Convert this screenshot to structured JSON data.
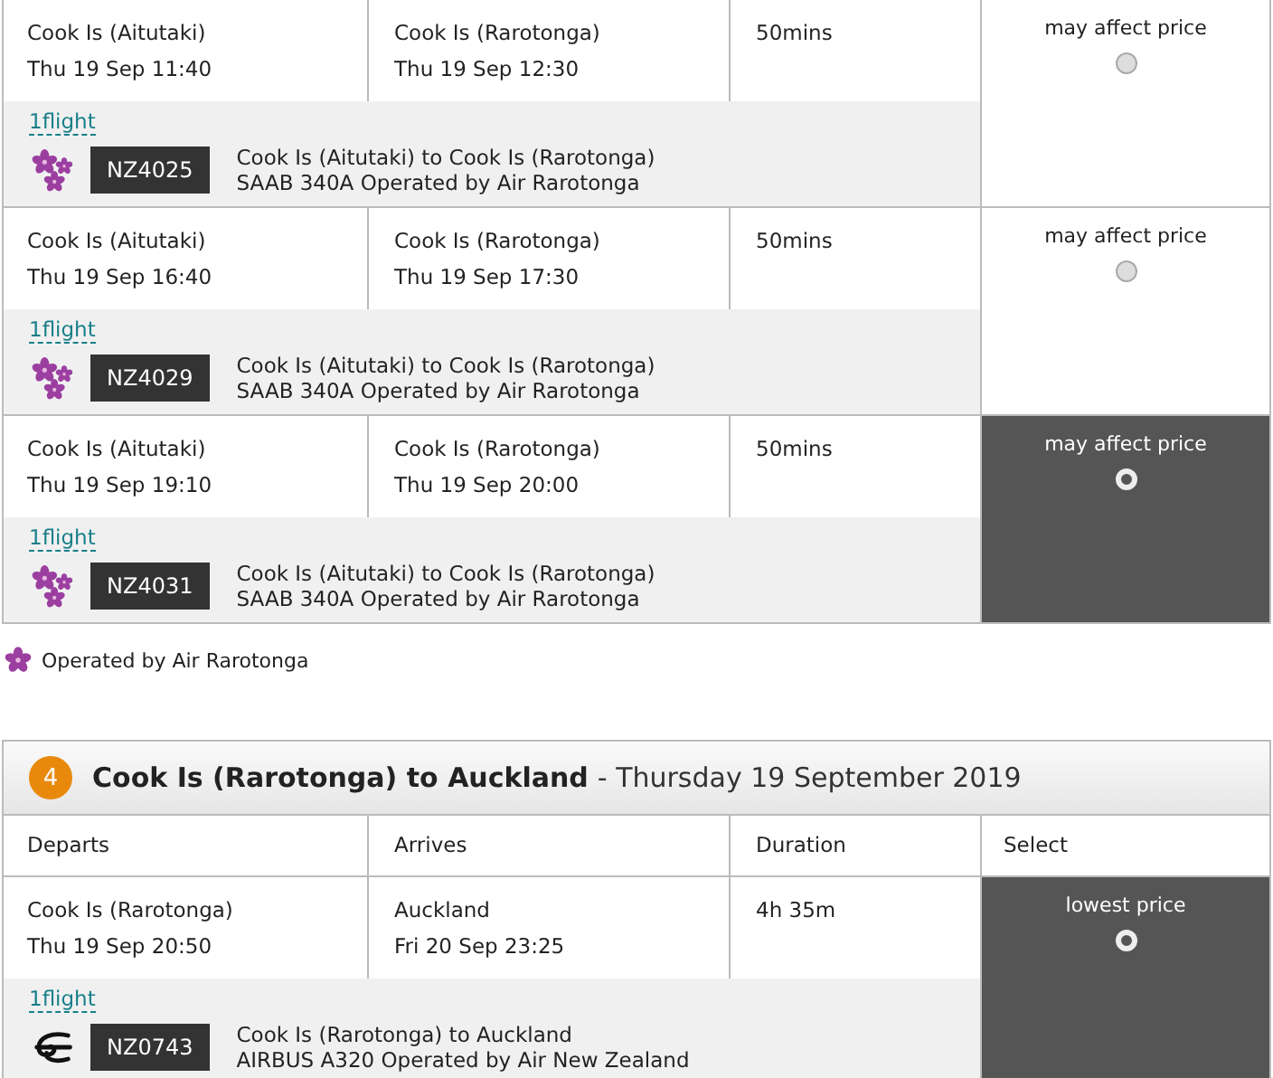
{
  "flights_top": [
    {
      "depart_place": "Cook Is (Aitutaki)",
      "depart_time": "Thu 19 Sep 11:40",
      "arrive_place": "Cook Is (Rarotonga)",
      "arrive_time": "Thu 19 Sep 12:30",
      "duration": "50mins",
      "price_note": "may affect price",
      "selected": false,
      "flights_link": "1flight",
      "kind": "flower",
      "flight_no": "NZ4025",
      "route": "Cook Is (Aitutaki) to Cook Is (Rarotonga)",
      "aircraft": "SAAB 340A Operated by Air Rarotonga"
    },
    {
      "depart_place": "Cook Is (Aitutaki)",
      "depart_time": "Thu 19 Sep 16:40",
      "arrive_place": "Cook Is (Rarotonga)",
      "arrive_time": "Thu 19 Sep 17:30",
      "duration": "50mins",
      "price_note": "may affect price",
      "selected": false,
      "flights_link": "1flight",
      "kind": "flower",
      "flight_no": "NZ4029",
      "route": "Cook Is (Aitutaki) to Cook Is (Rarotonga)",
      "aircraft": "SAAB 340A Operated by Air Rarotonga"
    },
    {
      "depart_place": "Cook Is (Aitutaki)",
      "depart_time": "Thu 19 Sep 19:10",
      "arrive_place": "Cook Is (Rarotonga)",
      "arrive_time": "Thu 19 Sep 20:00",
      "duration": "50mins",
      "price_note": "may affect price",
      "selected": true,
      "flights_link": "1flight",
      "kind": "flower",
      "flight_no": "NZ4031",
      "route": "Cook Is (Aitutaki) to Cook Is (Rarotonga)",
      "aircraft": "SAAB 340A Operated by Air Rarotonga"
    }
  ],
  "legend": {
    "kind": "flower",
    "text": "Operated by Air Rarotonga"
  },
  "section": {
    "number": "4",
    "title": "Cook Is (Rarotonga) to Auckland",
    "date": "- Thursday 19 September 2019",
    "columns": [
      "Departs",
      "Arrives",
      "Duration",
      "Select"
    ],
    "flights": [
      {
        "depart_place": "Cook Is (Rarotonga)",
        "depart_time": "Thu 19 Sep 20:50",
        "arrive_place": "Auckland",
        "arrive_time": "Fri 20 Sep 23:25",
        "duration": "4h 35m",
        "price_note": "lowest price",
        "selected": true,
        "flights_link": "1flight",
        "kind": "koru",
        "flight_no": "NZ0743",
        "route": "Cook Is (Rarotonga) to Auckland",
        "aircraft": "AIRBUS A320 Operated by Air New Zealand"
      }
    ]
  }
}
